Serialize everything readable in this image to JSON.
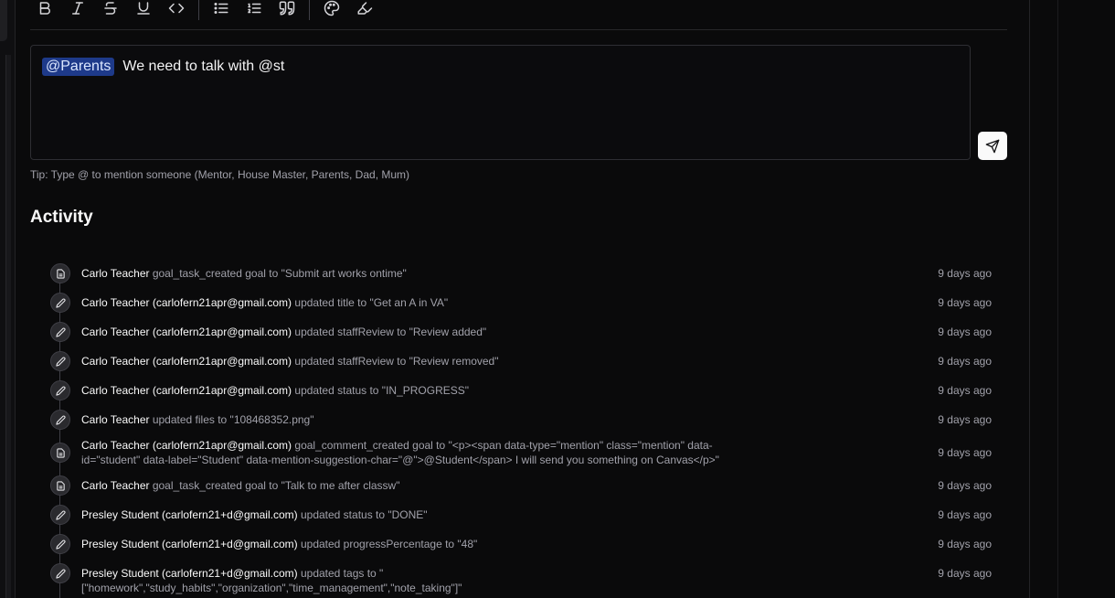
{
  "editor": {
    "mention": "@Parents",
    "text": "We need to talk with @st",
    "tip": "Tip: Type @ to mention someone (Mentor, House Master, Parents, Dad, Mum)"
  },
  "activity": {
    "title": "Activity",
    "items": [
      {
        "icon": "document-icon",
        "actor": "Carlo Teacher",
        "action": "goal_task_created goal to \"Submit art works ontime\"",
        "time": "9 days ago"
      },
      {
        "icon": "pencil-icon",
        "actor": "Carlo Teacher (carlofern21apr@gmail.com)",
        "action": "updated title to \"Get an A in VA\"",
        "time": "9 days ago"
      },
      {
        "icon": "pencil-icon",
        "actor": "Carlo Teacher (carlofern21apr@gmail.com)",
        "action": "updated staffReview to \"Review added\"",
        "time": "9 days ago"
      },
      {
        "icon": "pencil-icon",
        "actor": "Carlo Teacher (carlofern21apr@gmail.com)",
        "action": "updated staffReview to \"Review removed\"",
        "time": "9 days ago"
      },
      {
        "icon": "pencil-icon",
        "actor": "Carlo Teacher (carlofern21apr@gmail.com)",
        "action": "updated status to \"IN_PROGRESS\"",
        "time": "9 days ago"
      },
      {
        "icon": "pencil-icon",
        "actor": "Carlo Teacher",
        "action": "updated files to \"108468352.png\"",
        "time": "9 days ago"
      },
      {
        "icon": "document-icon",
        "actor": "Carlo Teacher (carlofern21apr@gmail.com)",
        "action": "goal_comment_created goal to \"<p><span data-type=\"mention\" class=\"mention\" data-id=\"student\" data-label=\"Student\" data-mention-suggestion-char=\"@\">@Student</span> I will send you something on Canvas</p>\"",
        "time": "9 days ago"
      },
      {
        "icon": "document-icon",
        "actor": "Carlo Teacher",
        "action": "goal_task_created goal to \"Talk to me after classw\"",
        "time": "9 days ago"
      },
      {
        "icon": "pencil-icon",
        "actor": "Presley Student (carlofern21+d@gmail.com)",
        "action": "updated status to \"DONE\"",
        "time": "9 days ago"
      },
      {
        "icon": "pencil-icon",
        "actor": "Presley Student (carlofern21+d@gmail.com)",
        "action": "updated progressPercentage to \"48\"",
        "time": "9 days ago"
      },
      {
        "icon": "pencil-icon",
        "actor": "Presley Student (carlofern21+d@gmail.com)",
        "action": "updated tags to \"[\"homework\",\"study_habits\",\"organization\",\"time_management\",\"note_taking\"]\"",
        "time": "9 days ago"
      }
    ]
  }
}
